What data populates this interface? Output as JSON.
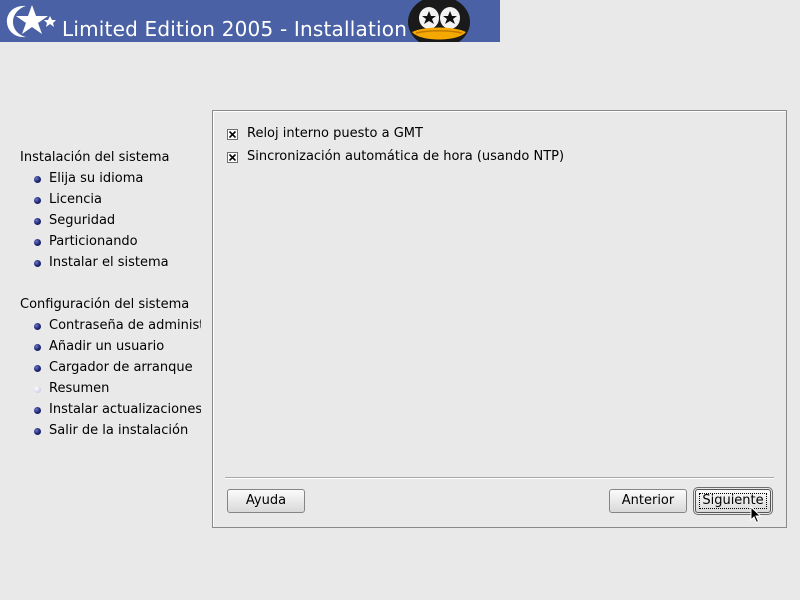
{
  "banner": {
    "title": "Limited Edition 2005 - Installation",
    "background_color": "#4a62a5",
    "logo_icon": "star-logo-icon",
    "mascot_icon": "penguin-mascot-icon"
  },
  "sidebar": {
    "groups": [
      {
        "title": "Instalación del sistema",
        "items": [
          {
            "label": "Elija su idioma",
            "state": "done"
          },
          {
            "label": "Licencia",
            "state": "done"
          },
          {
            "label": "Seguridad",
            "state": "done"
          },
          {
            "label": "Particionando",
            "state": "done"
          },
          {
            "label": "Instalar el sistema",
            "state": "done"
          }
        ]
      },
      {
        "title": "Configuración del sistema",
        "items": [
          {
            "label": "Contraseña de administi",
            "state": "done"
          },
          {
            "label": "Añadir un usuario",
            "state": "done"
          },
          {
            "label": "Cargador de arranque",
            "state": "done"
          },
          {
            "label": "Resumen",
            "state": "current"
          },
          {
            "label": "Instalar actualizaciones",
            "state": "done"
          },
          {
            "label": "Salir de la instalación",
            "state": "done"
          }
        ]
      }
    ]
  },
  "options": [
    {
      "label": "Reloj interno puesto a GMT",
      "checked": true
    },
    {
      "label": "Sincronización automática de hora (usando NTP)",
      "checked": true
    }
  ],
  "buttons": {
    "help": "Ayuda",
    "previous": "Anterior",
    "next": "Siguiente"
  }
}
